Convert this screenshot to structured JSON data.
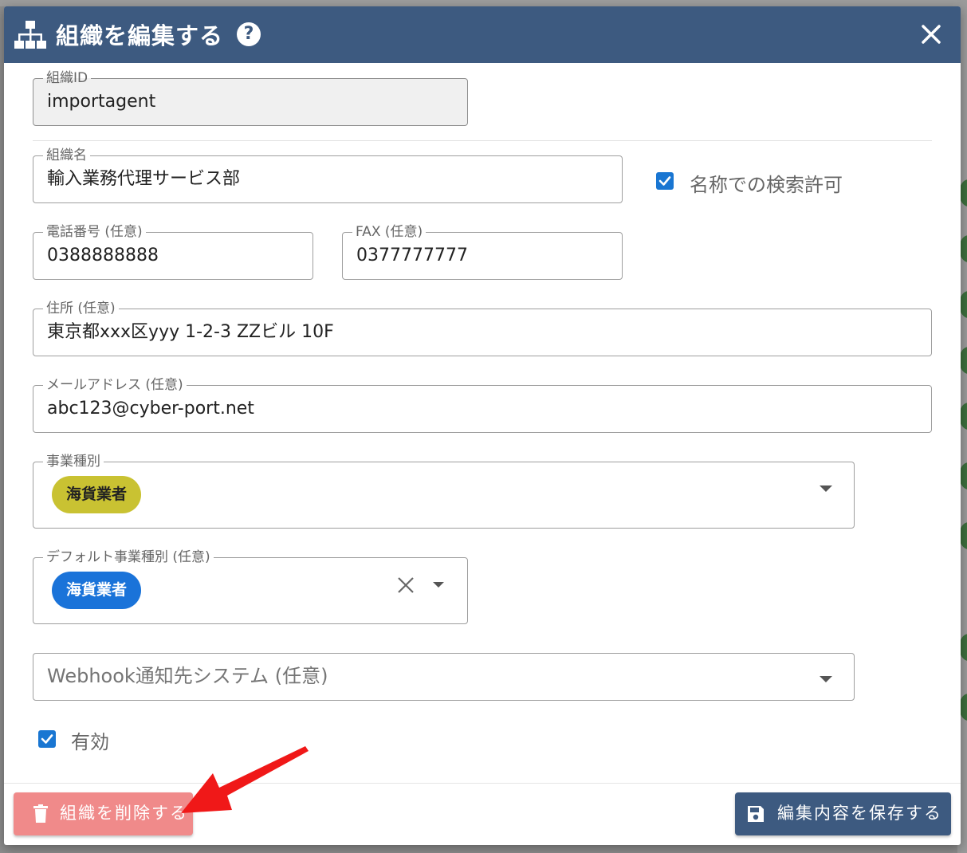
{
  "dialog": {
    "title": "組織を編集する",
    "help_icon": "question-circle-icon",
    "close_icon": "close-icon",
    "colors": {
      "header": "#3d5a80",
      "checkbox": "#1976d2",
      "delete": "#f08a8a"
    }
  },
  "form": {
    "org_id": {
      "label": "組織ID",
      "value": "importagent"
    },
    "org_name": {
      "label": "組織名",
      "value": "輸入業務代理サービス部"
    },
    "search_permit": {
      "label": "名称での検索許可",
      "checked": true
    },
    "phone": {
      "label": "電話番号 (任意)",
      "value": "0388888888"
    },
    "fax": {
      "label": "FAX (任意)",
      "value": "0377777777"
    },
    "address": {
      "label": "住所 (任意)",
      "value": "東京都xxx区yyy 1-2-3 ZZビル 10F"
    },
    "email": {
      "label": "メールアドレス (任意)",
      "value": "abc123@cyber-port.net"
    },
    "business_type": {
      "label": "事業種別",
      "chips": [
        "海貨業者"
      ],
      "chip_color": "#c9c232"
    },
    "default_business_type": {
      "label": "デフォルト事業種別 (任意)",
      "chips": [
        "海貨業者"
      ],
      "chip_color": "#1a73d9"
    },
    "webhook": {
      "placeholder": "Webhook通知先システム (任意)"
    },
    "enabled": {
      "label": "有効",
      "checked": true
    }
  },
  "footer": {
    "delete_label": "組織を削除する",
    "save_label": "編集内容を保存する"
  }
}
